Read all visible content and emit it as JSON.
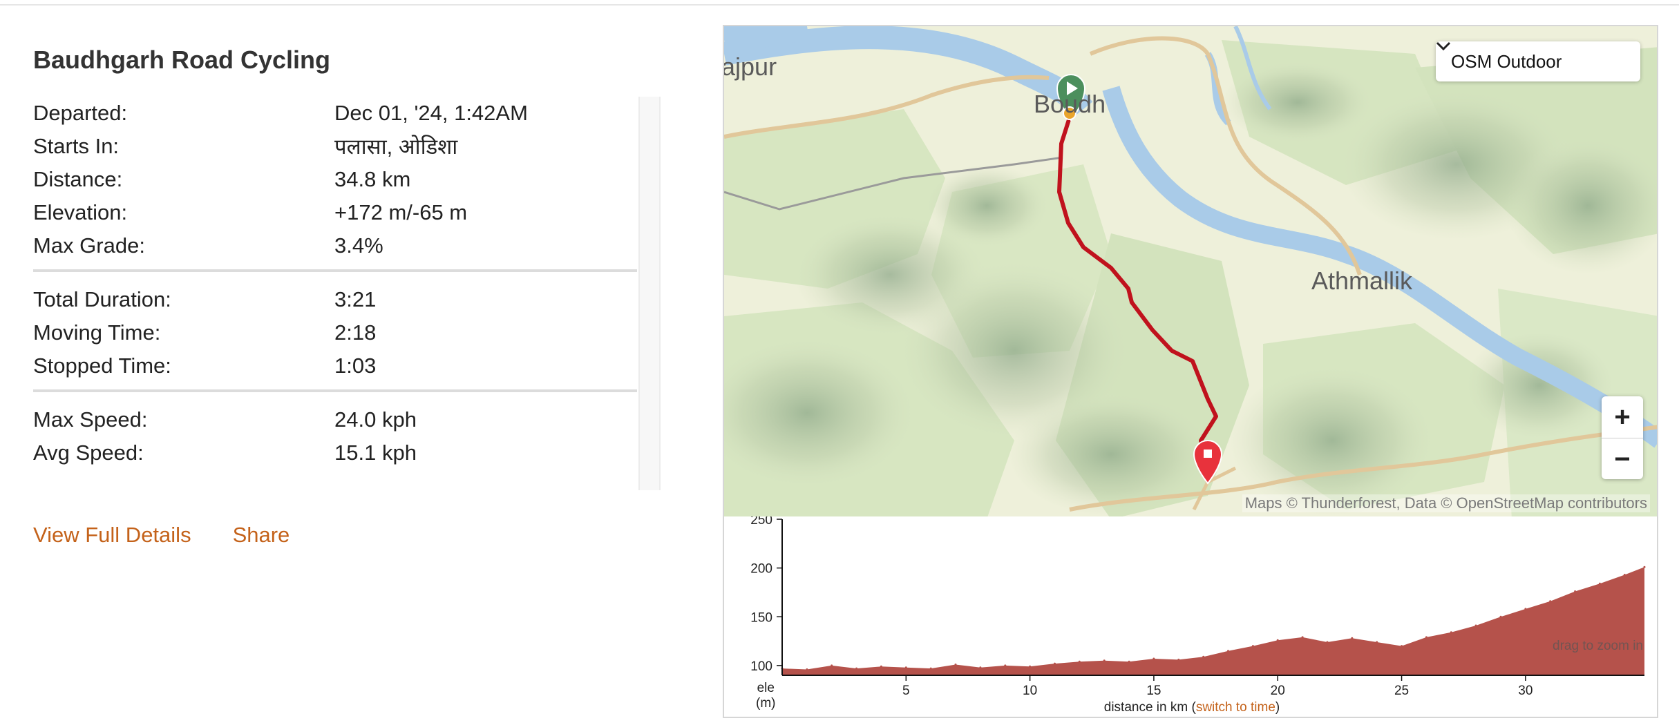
{
  "summary": {
    "title": "Baudhgarh Road Cycling",
    "rows": [
      {
        "label": "Departed:",
        "value": "Dec 01, '24, 1:42AM"
      },
      {
        "label": "Starts In:",
        "value": "पलासा, ओडिशा"
      },
      {
        "label": "Distance:",
        "value": "34.8 km"
      },
      {
        "label": "Elevation:",
        "value": "+172 m/-65 m"
      },
      {
        "label": "Max Grade:",
        "value": "3.4%"
      },
      {
        "label": "Total Duration:",
        "value": "3:21"
      },
      {
        "label": "Moving Time:",
        "value": "2:18"
      },
      {
        "label": "Stopped Time:",
        "value": "1:03"
      },
      {
        "label": "Max Speed:",
        "value": "24.0 kph"
      },
      {
        "label": "Avg Speed:",
        "value": "15.1 kph"
      }
    ],
    "actions": {
      "view_details": "View Full Details",
      "share": "Share"
    }
  },
  "map": {
    "layer": "OSM Outdoor",
    "places": {
      "left_partial": "ajpur",
      "boudh": "Boudh",
      "athmallik": "Athmallik"
    },
    "zoom_in": "+",
    "zoom_out": "−",
    "attribution": "Maps © Thunderforest, Data © OpenStreetMap contributors",
    "colors": {
      "route": "#c0121d",
      "start_marker": "#4c8f5d",
      "end_marker": "#e8323c",
      "river": "#a9cbe8"
    }
  },
  "elevation_chart": {
    "hint": "drag to zoom in",
    "ylabel_line1": "ele",
    "ylabel_line2": "(m)",
    "xlabel_prefix": "distance in km (",
    "xlabel_link": "switch to time",
    "xlabel_suffix": ")"
  },
  "chart_data": {
    "type": "area",
    "xlabel": "distance in km",
    "ylabel": "ele (m)",
    "xlim": [
      0,
      34.8
    ],
    "ylim": [
      90,
      250
    ],
    "x_ticks": [
      5,
      10,
      15,
      20,
      25,
      30
    ],
    "y_ticks": [
      100,
      150,
      200,
      250
    ],
    "color": "#b5524b",
    "x": [
      0,
      1,
      2,
      3,
      4,
      5,
      6,
      7,
      8,
      9,
      10,
      11,
      12,
      13,
      14,
      15,
      16,
      17,
      18,
      19,
      20,
      21,
      22,
      23,
      24,
      25,
      26,
      27,
      28,
      29,
      30,
      31,
      32,
      33,
      34,
      34.8
    ],
    "values": [
      97,
      96,
      100,
      97,
      99,
      98,
      97,
      101,
      98,
      100,
      99,
      102,
      104,
      105,
      104,
      107,
      106,
      109,
      115,
      120,
      126,
      129,
      124,
      128,
      124,
      120,
      129,
      134,
      141,
      150,
      158,
      166,
      176,
      184,
      193,
      201
    ]
  }
}
